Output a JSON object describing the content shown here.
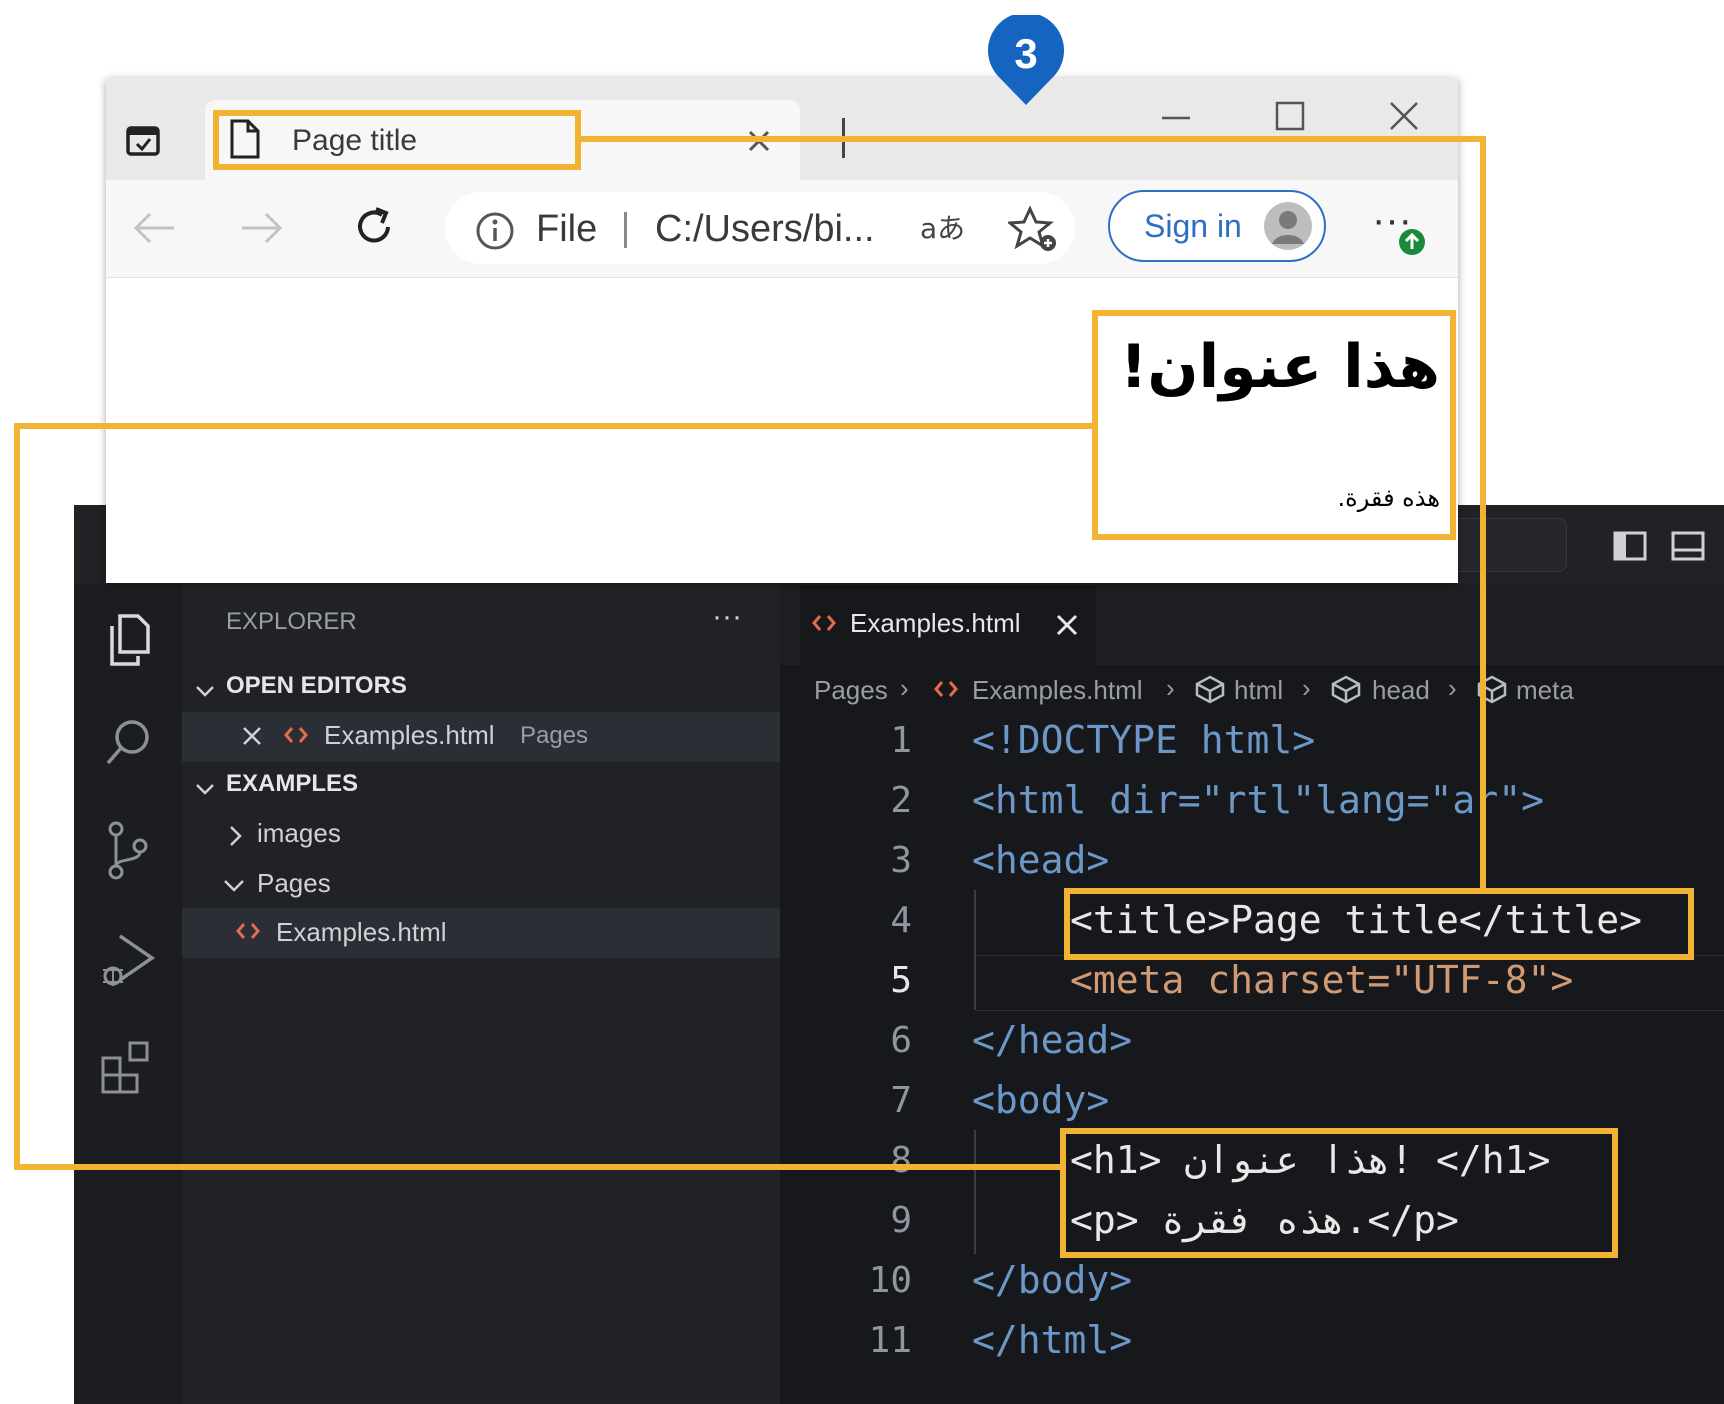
{
  "callout": {
    "number": "3",
    "color": "#1565c0"
  },
  "browser": {
    "tab_title": "Page title",
    "address_scheme": "File",
    "address_path": "C:/Users/bi...",
    "sign_in_label": "Sign in",
    "page_heading": "هذا عنوان!",
    "page_paragraph": "هذه فقرة."
  },
  "vscode": {
    "explorer_label": "EXPLORER",
    "explorer_more": "···",
    "open_editors_label": "OPEN EDITORS",
    "open_editor_item": {
      "name": "Examples.html",
      "folder": "Pages"
    },
    "workspace_label": "EXAMPLES",
    "tree": [
      {
        "label": "images",
        "expanded": false
      },
      {
        "label": "Pages",
        "expanded": true
      },
      {
        "label": "Examples.html",
        "selected": true
      }
    ],
    "editor_tab": "Examples.html",
    "breadcrumb": [
      "Pages",
      "Examples.html",
      "html",
      "head",
      "meta"
    ],
    "code_lines": [
      {
        "num": "1",
        "text": "<!DOCTYPE html>"
      },
      {
        "num": "2",
        "text": "<html dir=\"rtl\"lang=\"ar\">"
      },
      {
        "num": "3",
        "text": "<head>"
      },
      {
        "num": "4",
        "text": "<title>Page title</title>"
      },
      {
        "num": "5",
        "text": "<meta charset=\"UTF-8\">"
      },
      {
        "num": "6",
        "text": "</head>"
      },
      {
        "num": "7",
        "text": "<body>"
      },
      {
        "num": "8",
        "text": "<h1> هذا عنوان! </h1>"
      },
      {
        "num": "9",
        "text": "<p> هذه فقرة.</p>"
      },
      {
        "num": "10",
        "text": "</body>"
      },
      {
        "num": "11",
        "text": "</html>"
      }
    ]
  },
  "highlight_color": "#f2b233"
}
